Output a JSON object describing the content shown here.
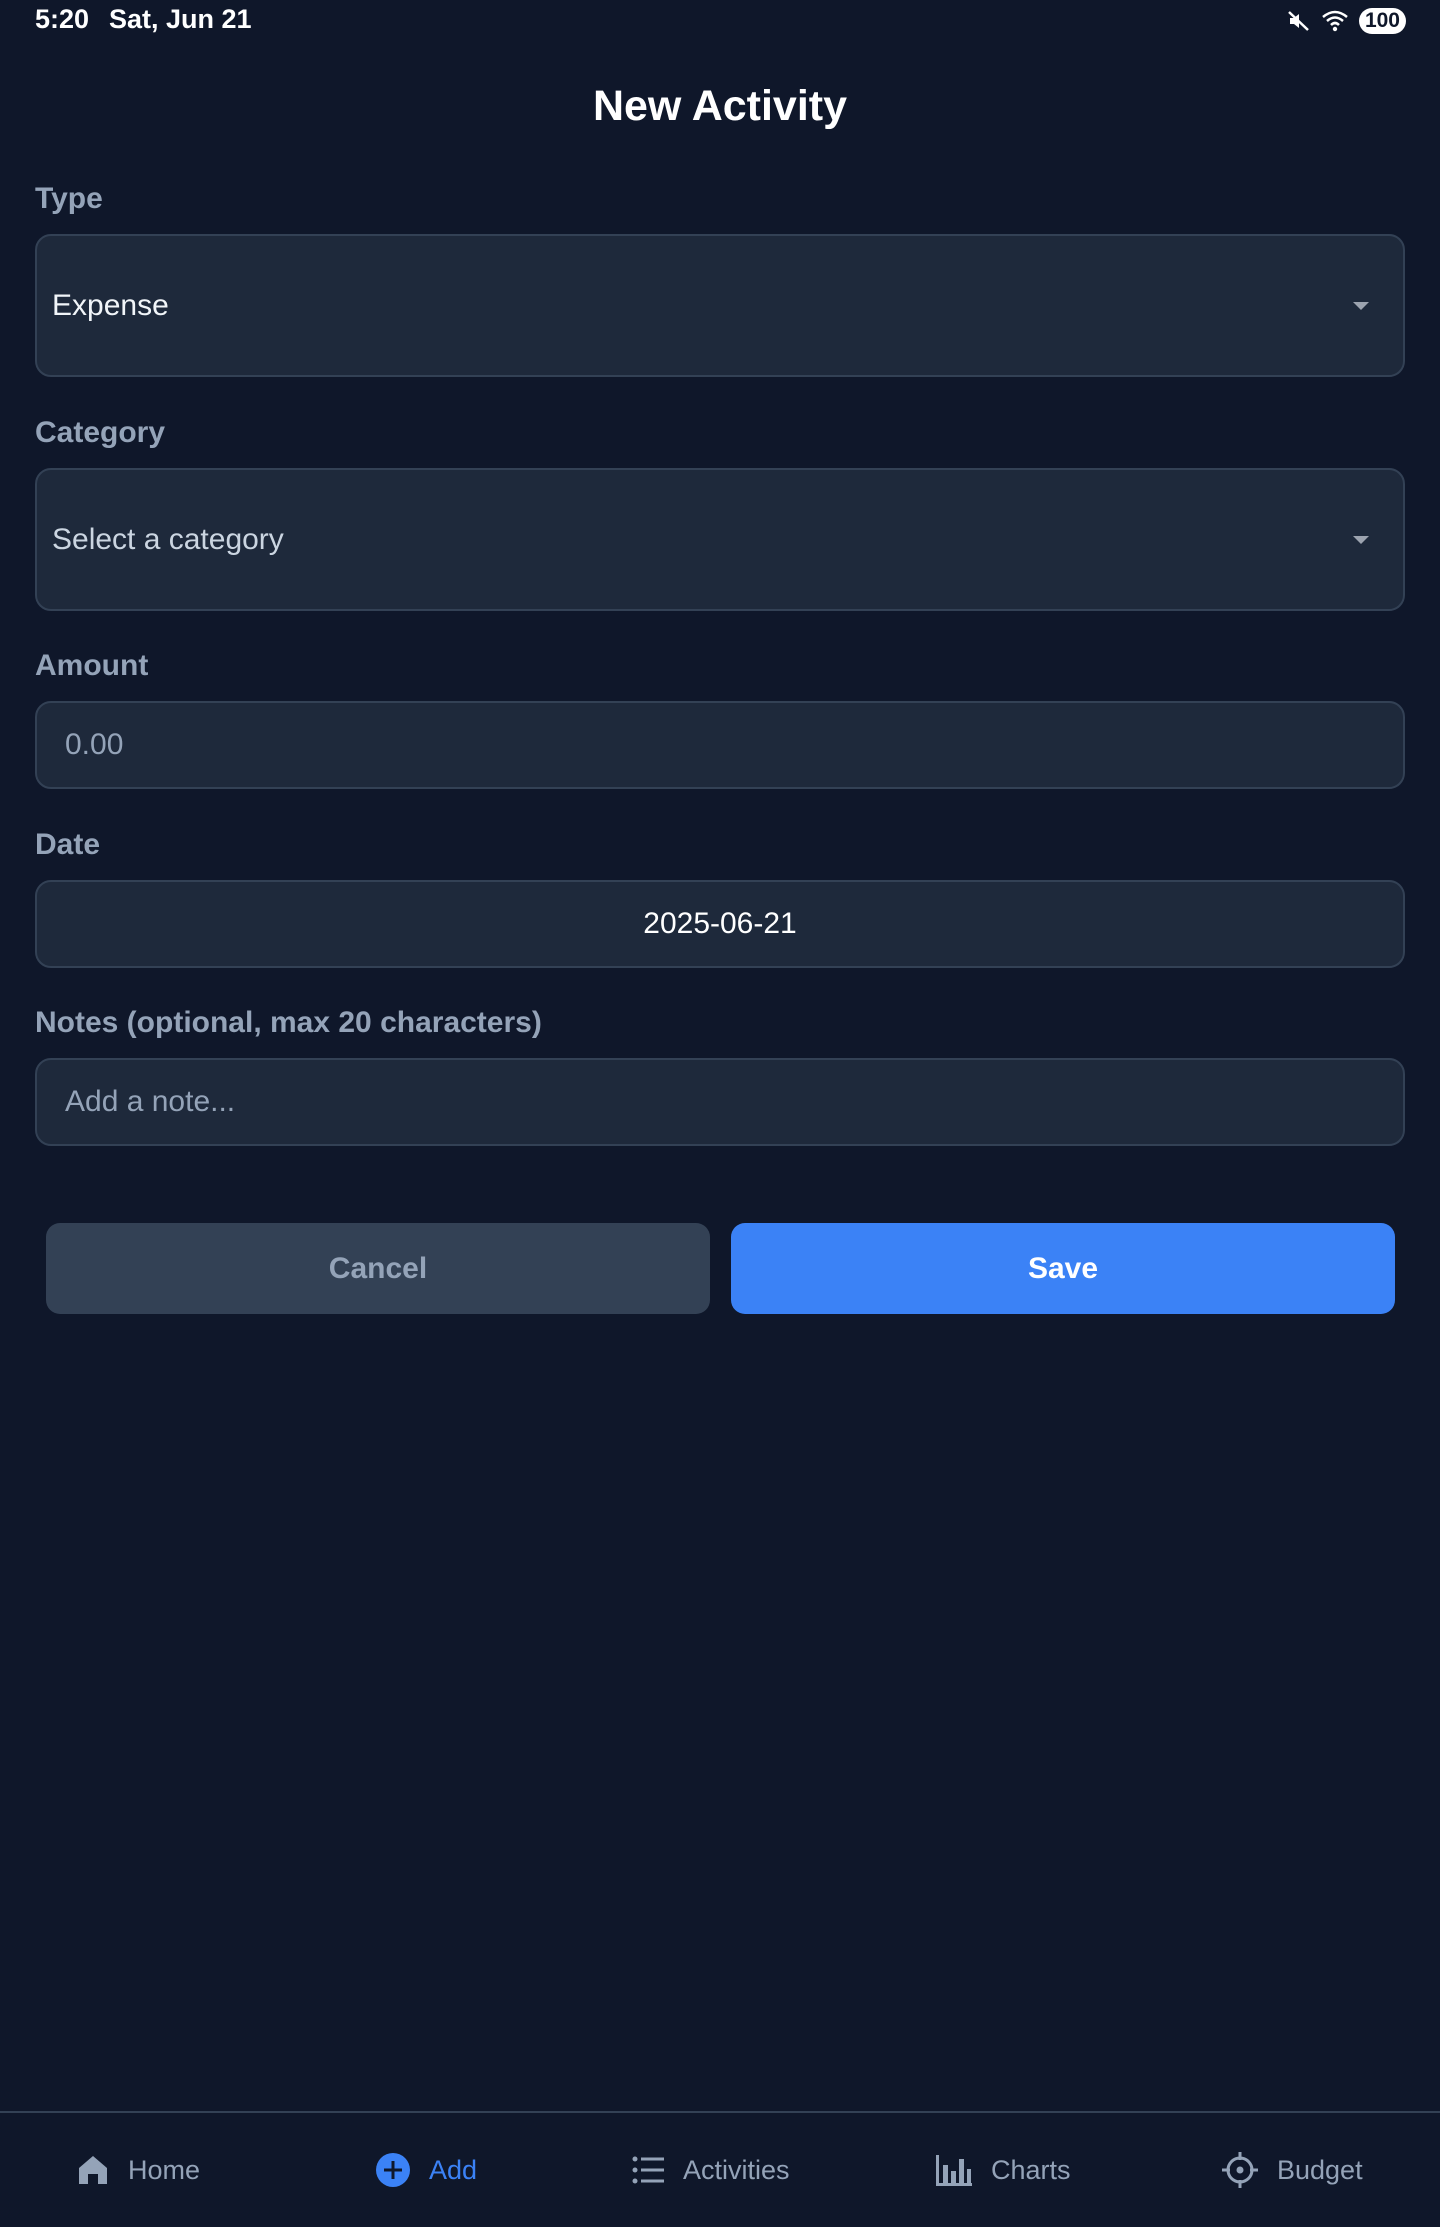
{
  "status_bar": {
    "time": "5:20",
    "date": "Sat, Jun 21",
    "battery": "100",
    "icons": [
      "mute-icon",
      "wifi-icon",
      "battery-icon"
    ]
  },
  "header": {
    "title": "New Activity"
  },
  "form": {
    "type": {
      "label": "Type",
      "value": "Expense"
    },
    "category": {
      "label": "Category",
      "value": "Select a category"
    },
    "amount": {
      "label": "Amount",
      "placeholder": "0.00"
    },
    "date": {
      "label": "Date",
      "value": "2025-06-21"
    },
    "notes": {
      "label": "Notes (optional, max 20 characters)",
      "placeholder": "Add a note..."
    }
  },
  "actions": {
    "cancel_label": "Cancel",
    "save_label": "Save"
  },
  "bottom_nav": {
    "items": [
      {
        "label": "Home",
        "icon": "home-icon",
        "active": false
      },
      {
        "label": "Add",
        "icon": "plus-circle-icon",
        "active": true
      },
      {
        "label": "Activities",
        "icon": "list-icon",
        "active": false
      },
      {
        "label": "Charts",
        "icon": "bar-chart-icon",
        "active": false
      },
      {
        "label": "Budget",
        "icon": "target-icon",
        "active": false
      }
    ]
  },
  "colors": {
    "background": "#0f172a",
    "field_bg": "#1e293b",
    "field_border": "#334155",
    "label": "#94a3b8",
    "accent": "#3b82f6",
    "cancel_bg": "#334155"
  }
}
